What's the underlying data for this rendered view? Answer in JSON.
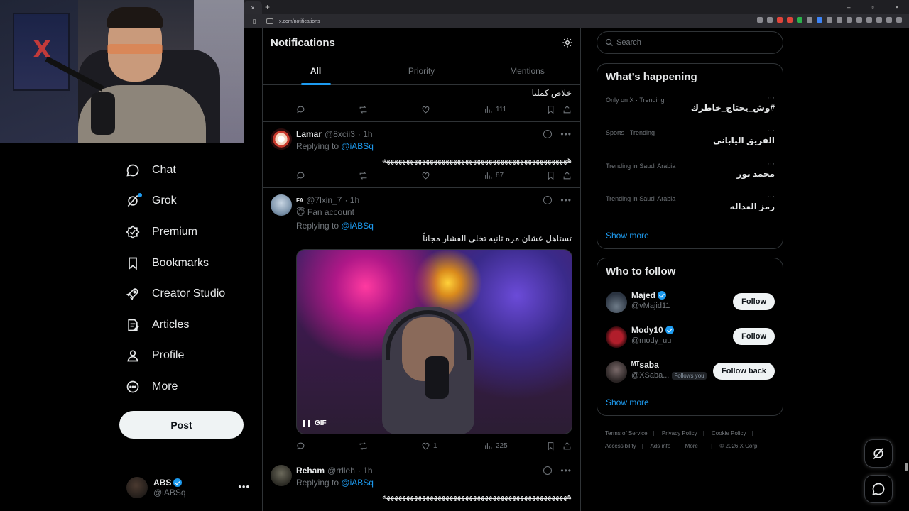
{
  "browser": {
    "tab_close": "×",
    "new_tab": "+",
    "url": "x.com/notifications",
    "window_controls": [
      "–",
      "▫",
      "×"
    ]
  },
  "nav": {
    "items": [
      {
        "label": "Chat",
        "icon": "chat-icon"
      },
      {
        "label": "Grok",
        "icon": "grok-icon"
      },
      {
        "label": "Premium",
        "icon": "premium-icon"
      },
      {
        "label": "Bookmarks",
        "icon": "bookmark-icon"
      },
      {
        "label": "Creator Studio",
        "icon": "rocket-icon"
      },
      {
        "label": "Articles",
        "icon": "article-icon"
      },
      {
        "label": "Profile",
        "icon": "profile-icon"
      },
      {
        "label": "More",
        "icon": "more-icon"
      }
    ],
    "post_label": "Post",
    "account": {
      "name": "ABS",
      "handle": "@iABSq",
      "more": "•••"
    }
  },
  "main": {
    "title": "Notifications",
    "tabs": [
      {
        "label": "All",
        "active": true
      },
      {
        "label": "Priority",
        "active": false
      },
      {
        "label": "Mentions",
        "active": false
      }
    ],
    "posts": [
      {
        "text": "خلاص كملنا",
        "views": "111"
      },
      {
        "name": "Lamar",
        "handle": "@8xcii3",
        "time": "· 1h",
        "replying_prefix": "Replying to",
        "replying_to": "@iABSq",
        "text": "هههههههههههههههههههههههههههههههههههههههههههههههه",
        "views": "87"
      },
      {
        "name": "FA",
        "handle": "@7lxin_7",
        "time": "· 1h",
        "badge": "Fan account",
        "replying_prefix": "Replying to",
        "replying_to": "@iABSq",
        "text": "تستاهل عشان مره ثانيه تخلي الفشار مجاناً",
        "gif_label": "GIF",
        "likes": "1",
        "views": "225"
      },
      {
        "name": "Reham",
        "handle": "@rrlleh",
        "time": "· 1h",
        "replying_prefix": "Replying to",
        "replying_to": "@iABSq",
        "text": "هههههههههههههههههههههههههههههههههههههههههههههههه"
      }
    ]
  },
  "right": {
    "search_placeholder": "Search",
    "happening": {
      "title": "What’s happening",
      "trends": [
        {
          "meta": "Only on X · Trending",
          "title": "#وش_يحتاج_خاطرك"
        },
        {
          "meta": "Sports · Trending",
          "title": "الفريق الياباني"
        },
        {
          "meta": "Trending in Saudi Arabia",
          "title": "محمد نور"
        },
        {
          "meta": "Trending in Saudi Arabia",
          "title": "رمز العداله"
        }
      ],
      "more_dots": "···",
      "show_more": "Show more"
    },
    "who_to_follow": {
      "title": "Who to follow",
      "users": [
        {
          "name": "Majed",
          "handle": "@vMajid11",
          "verified": true,
          "button": "Follow"
        },
        {
          "name": "Mody10",
          "handle": "@mody_uu",
          "verified": true,
          "button": "Follow"
        },
        {
          "name": "ᴹᵀsaba",
          "handle": "@XSaba...",
          "verified": false,
          "follows_you": "Follows you",
          "button": "Follow back"
        }
      ],
      "show_more": "Show more"
    },
    "footer": [
      "Terms of Service",
      "Privacy Policy",
      "Cookie Policy",
      "Accessibility",
      "Ads info",
      "More ···",
      "© 2026 X Corp."
    ]
  },
  "colors": {
    "accent": "#1d9bf0",
    "background": "#000000",
    "border": "#2f3336",
    "muted": "#71767b"
  }
}
